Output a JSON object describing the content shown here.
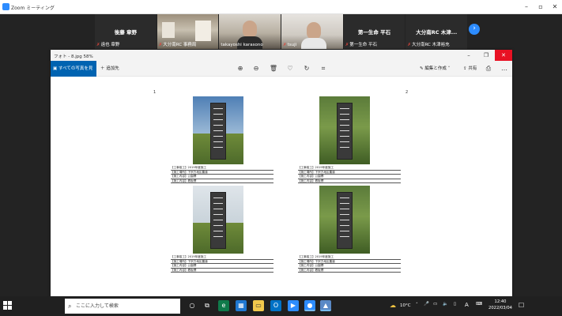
{
  "zoom": {
    "window_title": "Zoom ミーティング",
    "participants": [
      {
        "center_name": "後藤 章野",
        "label": "遠也 章野",
        "muted": true
      },
      {
        "center_name": "",
        "label": "大分南RC 事務局",
        "muted": true
      },
      {
        "center_name": "",
        "label": "takayoshi karasono",
        "muted": false
      },
      {
        "center_name": "",
        "label": "tsuji",
        "muted": true
      },
      {
        "center_name": "第一生命 平石",
        "label": "第一生命 平石",
        "muted": true
      },
      {
        "center_name": "大分南RC 木津...",
        "label": "大分南RC 木津裕充",
        "muted": true
      }
    ]
  },
  "photos": {
    "title": "フォト - 8.jpg   58%",
    "see_all_label": "すべての写真を見る",
    "add_to_label": "追加先",
    "edit_create_label": "編集と作成",
    "share_label": "共有",
    "more_label": "…"
  },
  "document": {
    "page_left": "1",
    "page_right": "2",
    "captions": [
      [
        "【工事竣工】2019年度施工",
        "【施工場所】下宗方地区農道",
        "【施工内容】公園標",
        "【施工内容】看板標"
      ],
      [
        "【工事竣工】2019年度施工",
        "【施工場所】下宗方地区農道",
        "【施工内容】公園標",
        "【施工内容】看板標"
      ],
      [
        "【工事竣工】2019年度施工",
        "【施工場所】下宗方地区農道",
        "【施工内容】公園標",
        "【施工内容】看板標"
      ],
      [
        "【工事竣工】2019年度施工",
        "【施工場所】下宗方地区農道",
        "【施工内容】公園標",
        "【施工内容】看板標"
      ]
    ]
  },
  "taskbar": {
    "search_placeholder": "ここに入力して検索",
    "temperature": "10°C",
    "ime": "A",
    "time": "12:40",
    "date": "2022/03/04"
  },
  "colors": {
    "accent": "#0063b1",
    "close": "#e81123",
    "zoom_blue": "#2d8cff",
    "mute_red": "#e0453a"
  }
}
